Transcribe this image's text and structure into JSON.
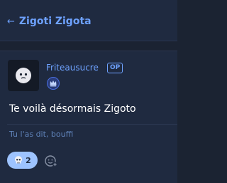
{
  "header": {
    "back_arrow": "←",
    "title": "Zigoti Zigota"
  },
  "post": {
    "username": "Friteausucre",
    "op_badge": "OP",
    "avatar_icon": "ghost-face-icon",
    "badge_icon": "crown-icon",
    "content": "Te voilà désormais Zigoto",
    "reply_text": "Tu l'as dit, bouffi",
    "reactions": [
      {
        "icon": "skull-icon",
        "count": "2"
      }
    ],
    "add_reaction_icon": "add-emoji-icon"
  },
  "colors": {
    "background": "#1b2332",
    "card": "#1f2a40",
    "accent": "#6ea2ff",
    "reaction_pill": "#9dc3ff"
  }
}
